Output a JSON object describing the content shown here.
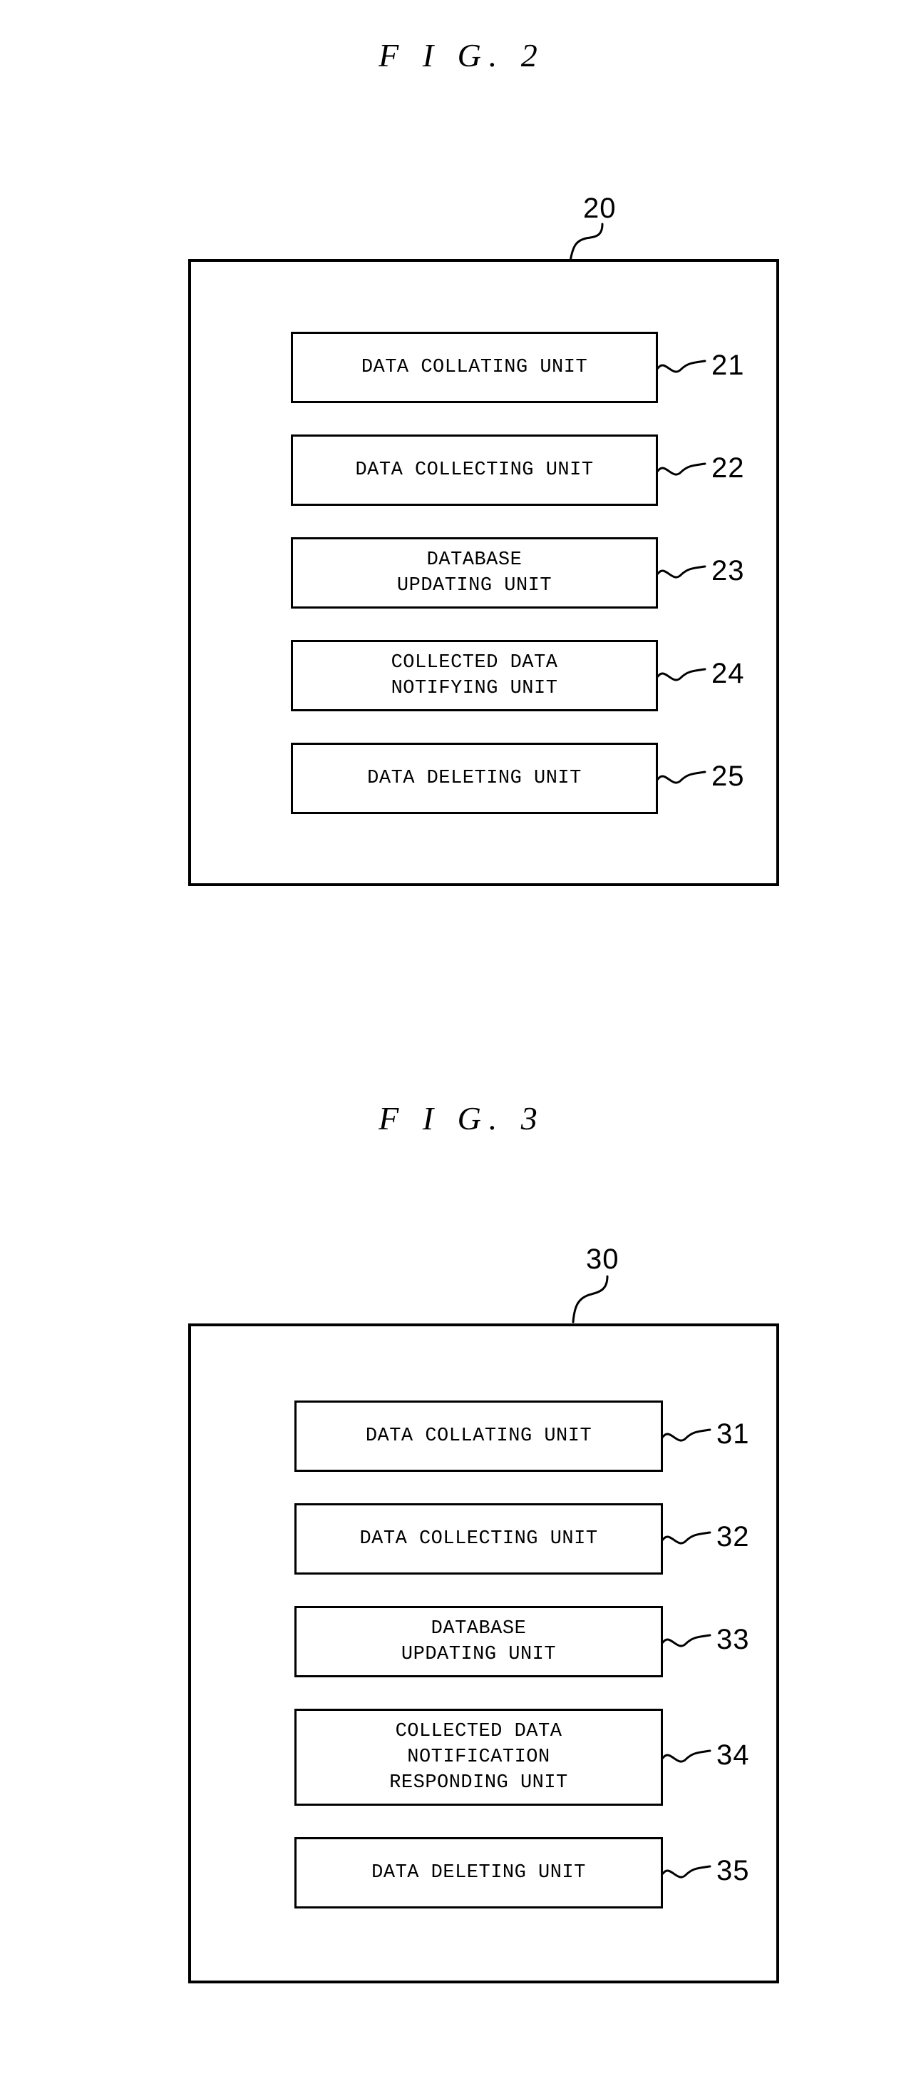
{
  "document": {
    "type": "patent-drawing-sheet",
    "figures": [
      {
        "title": "F I G. 2",
        "apparatus_ref": "20",
        "units": [
          {
            "label": "DATA COLLATING UNIT",
            "ref": "21",
            "lines": 1
          },
          {
            "label": "DATA COLLECTING UNIT",
            "ref": "22",
            "lines": 1
          },
          {
            "label": "DATABASE\nUPDATING UNIT",
            "ref": "23",
            "lines": 2
          },
          {
            "label": "COLLECTED DATA\nNOTIFYING UNIT",
            "ref": "24",
            "lines": 2
          },
          {
            "label": "DATA DELETING UNIT",
            "ref": "25",
            "lines": 1
          }
        ]
      },
      {
        "title": "F I G. 3",
        "apparatus_ref": "30",
        "units": [
          {
            "label": "DATA COLLATING UNIT",
            "ref": "31",
            "lines": 1
          },
          {
            "label": "DATA COLLECTING UNIT",
            "ref": "32",
            "lines": 1
          },
          {
            "label": "DATABASE\nUPDATING UNIT",
            "ref": "33",
            "lines": 2
          },
          {
            "label": "COLLECTED DATA\nNOTIFICATION\nRESPONDING UNIT",
            "ref": "34",
            "lines": 3
          },
          {
            "label": "DATA DELETING UNIT",
            "ref": "35",
            "lines": 1
          }
        ]
      }
    ],
    "colors": {
      "ink": "#000000",
      "paper": "#ffffff"
    }
  }
}
